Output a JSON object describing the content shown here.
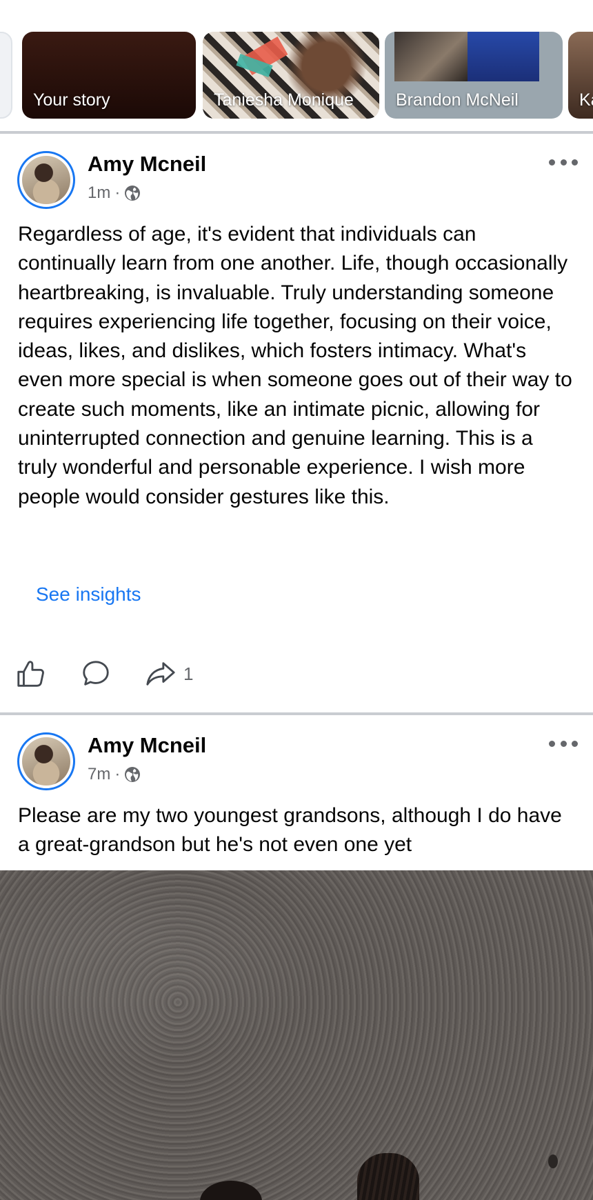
{
  "stories": [
    {
      "label": ""
    },
    {
      "label": "Your story"
    },
    {
      "label": "Taniesha Monique"
    },
    {
      "label": "Brandon McNeil"
    },
    {
      "label": "Ka"
    }
  ],
  "posts": [
    {
      "author": "Amy Mcneil",
      "time": "1m",
      "separator": "·",
      "privacy_icon": "globe-icon",
      "text": "Regardless of age, it's evident that individuals can continually learn from one another. Life, though occasionally heartbreaking, is invaluable. Truly understanding someone requires experiencing life together, focusing on their voice, ideas, likes, and dislikes, which fosters intimacy. What's even more special is when someone goes out of their way to create such moments, like an intimate picnic, allowing for uninterrupted connection and genuine learning. This is a truly wonderful and personable experience. I wish more people would consider gestures like this.",
      "insights_label": "See insights",
      "share_count": "1"
    },
    {
      "author": "Amy Mcneil",
      "time": "7m",
      "separator": "·",
      "privacy_icon": "globe-icon",
      "text": "Please are my two youngest grandsons, although I do have a great-grandson but he's not even one yet"
    }
  ],
  "colors": {
    "accent": "#1877f2",
    "secondary_text": "#65676b",
    "divider": "#c9ccd1"
  }
}
